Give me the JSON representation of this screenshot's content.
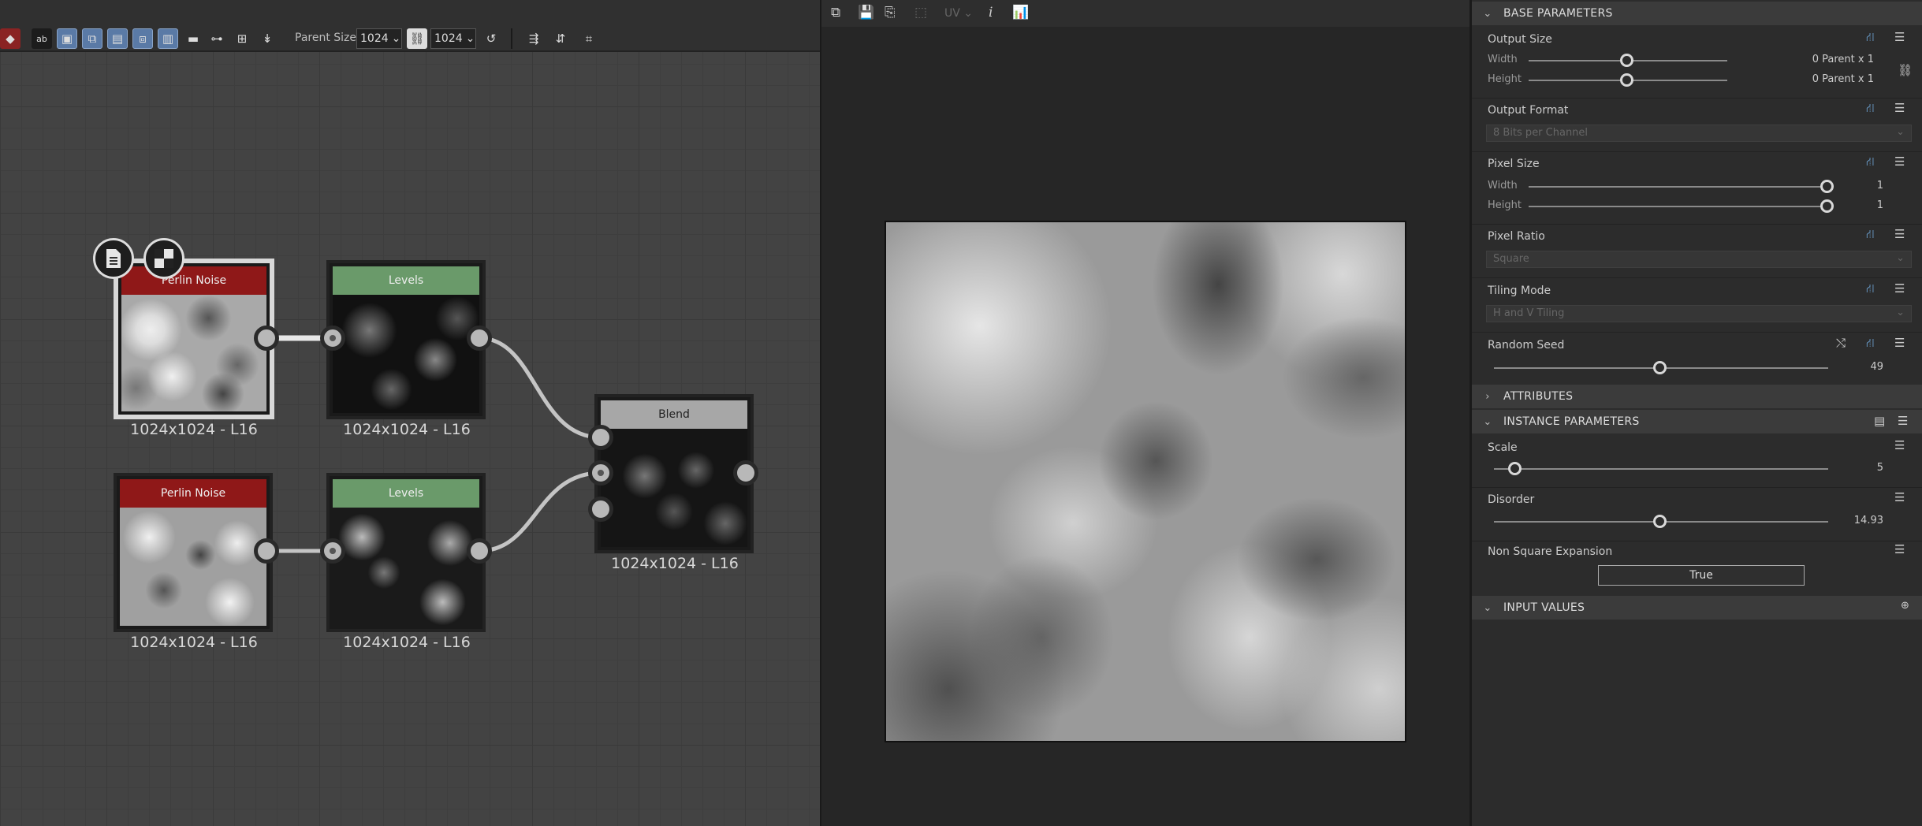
{
  "toolbar": {
    "parent_size_label": "Parent Size:",
    "parent_size_width": "1024",
    "parent_size_height": "1024",
    "icons": [
      "paint-bucket-icon",
      "ab01-icon",
      "frame-icon",
      "node-frame-icon",
      "node-plus-icon",
      "node-export-icon",
      "node-comment-icon",
      "comment-icon",
      "pin-icon",
      "nodes-icon",
      "pin-down-icon",
      "link-icon",
      "reset-icon",
      "align-icon",
      "align-vertical-icon",
      "crop-icon"
    ]
  },
  "graph": {
    "nodes": [
      {
        "id": "perlin1",
        "title": "Perlin Noise",
        "label": "1024x1024 - L16",
        "color": "#8f1818",
        "selected": true
      },
      {
        "id": "levels1",
        "title": "Levels",
        "label": "1024x1024 - L16",
        "color": "#6a9a6a"
      },
      {
        "id": "blend",
        "title": "Blend",
        "label": "1024x1024 - L16",
        "color": "#a7a7a7"
      },
      {
        "id": "perlin2",
        "title": "Perlin Noise",
        "label": "1024x1024 - L16",
        "color": "#8f1818"
      },
      {
        "id": "levels2",
        "title": "Levels",
        "label": "1024x1024 - L16",
        "color": "#6a9a6a"
      }
    ]
  },
  "viewer": {
    "uv_label": "UV",
    "info_label": "i"
  },
  "props": {
    "base_parameters": "BASE PARAMETERS",
    "output_size": {
      "label": "Output Size",
      "width_label": "Width",
      "width_value": "0",
      "width_suffix": "Parent x 1",
      "height_label": "Height",
      "height_value": "0",
      "height_suffix": "Parent x 1"
    },
    "output_format": {
      "label": "Output Format",
      "value": "8 Bits per Channel"
    },
    "pixel_size": {
      "label": "Pixel Size",
      "width_label": "Width",
      "width_value": "1",
      "height_label": "Height",
      "height_value": "1"
    },
    "pixel_ratio": {
      "label": "Pixel Ratio",
      "value": "Square"
    },
    "tiling_mode": {
      "label": "Tiling Mode",
      "value": "H and V Tiling"
    },
    "random_seed": {
      "label": "Random Seed",
      "value": "49",
      "level": 0.5
    },
    "attributes": "ATTRIBUTES",
    "instance_parameters": "INSTANCE PARAMETERS",
    "scale": {
      "label": "Scale",
      "value": "5",
      "level": 0.06
    },
    "disorder": {
      "label": "Disorder",
      "value": "14.93",
      "level": 0.5
    },
    "non_square": {
      "label": "Non Square Expansion",
      "value": "True"
    },
    "input_values": "INPUT VALUES"
  }
}
